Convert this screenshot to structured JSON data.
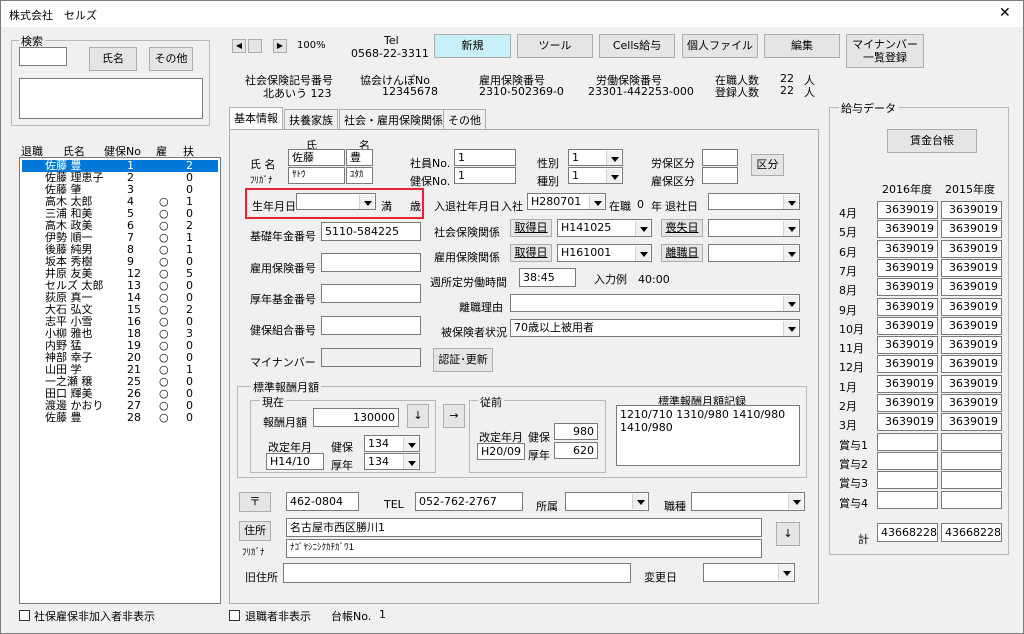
{
  "window": {
    "title": "株式会社　セルズ",
    "close": "✕"
  },
  "search": {
    "group": "検索",
    "name_button": "氏名",
    "other_button": "その他"
  },
  "list": {
    "headers": [
      "退職",
      "氏名",
      "健保No",
      "雇",
      "扶"
    ],
    "rows": [
      {
        "name": "佐藤 豊",
        "no": "1",
        "koyo": "",
        "fu": "2"
      },
      {
        "name": "佐藤 理恵子",
        "no": "2",
        "koyo": "",
        "fu": "0"
      },
      {
        "name": "佐藤 肇",
        "no": "3",
        "koyo": "",
        "fu": "0"
      },
      {
        "name": "高木 太郎",
        "no": "4",
        "koyo": "○",
        "fu": "1"
      },
      {
        "name": "三浦 和美",
        "no": "5",
        "koyo": "○",
        "fu": "0"
      },
      {
        "name": "高木 政美",
        "no": "6",
        "koyo": "○",
        "fu": "2"
      },
      {
        "name": "伊勢 順一",
        "no": "7",
        "koyo": "○",
        "fu": "1"
      },
      {
        "name": "後藤 純男",
        "no": "8",
        "koyo": "○",
        "fu": "1"
      },
      {
        "name": "坂本 秀樹",
        "no": "9",
        "koyo": "○",
        "fu": "0"
      },
      {
        "name": "井原 友美",
        "no": "12",
        "koyo": "○",
        "fu": "5"
      },
      {
        "name": "セルズ 太郎",
        "no": "13",
        "koyo": "○",
        "fu": "0"
      },
      {
        "name": "荻原 真一",
        "no": "14",
        "koyo": "○",
        "fu": "0"
      },
      {
        "name": "大石 弘文",
        "no": "15",
        "koyo": "○",
        "fu": "2"
      },
      {
        "name": "志平 小雪",
        "no": "16",
        "koyo": "○",
        "fu": "0"
      },
      {
        "name": "小柳 雅也",
        "no": "18",
        "koyo": "○",
        "fu": "3"
      },
      {
        "name": "内野 猛",
        "no": "19",
        "koyo": "○",
        "fu": "0"
      },
      {
        "name": "神部 幸子",
        "no": "20",
        "koyo": "○",
        "fu": "0"
      },
      {
        "name": "山田 学",
        "no": "21",
        "koyo": "○",
        "fu": "1"
      },
      {
        "name": "一之瀬 穣",
        "no": "25",
        "koyo": "○",
        "fu": "0"
      },
      {
        "name": "田口 輝美",
        "no": "26",
        "koyo": "○",
        "fu": "0"
      },
      {
        "name": "渡邊 かおり",
        "no": "27",
        "koyo": "○",
        "fu": "0"
      },
      {
        "name": "佐藤 豊",
        "no": "28",
        "koyo": "○",
        "fu": "0"
      }
    ]
  },
  "bottom": {
    "hide_uninsured": "社保雇保非加入者非表示",
    "hide_retired": "退職者非表示",
    "ledger_label": "台帳No.",
    "ledger_no": "1"
  },
  "toolbar": {
    "zoom": "100%",
    "tel_label": "Tel",
    "tel": "0568-22-3311",
    "new": "新規",
    "tools": "ツール",
    "cells_pay": "Cells給与",
    "personal_file": "個人ファイル",
    "edit": "編集",
    "mynumber": "マイナンバー\n一覧登録"
  },
  "info": {
    "social_ins_label": "社会保険記号番号",
    "social_ins": "北あいう 123",
    "kyokai_label": "協会けんぽNo",
    "kyokai": "12345678",
    "employment_label": "雇用保険番号",
    "employment": "2310-502369-0",
    "labor_label": "労働保険番号",
    "labor": "23301-442253-000",
    "employed_label": "在職人数",
    "employed": "22",
    "registered_label": "登録人数",
    "registered": "22",
    "unit": "人"
  },
  "tabs": [
    "基本情報",
    "扶養家族",
    "社会・雇用保険関係",
    "その他"
  ],
  "basic": {
    "sei": "氏",
    "mei": "名",
    "name_label": "氏 名",
    "furigana_label": "ﾌﾘｶﾞﾅ",
    "last": "佐藤",
    "first": "豊",
    "last_kana": "ｻﾄｳ",
    "first_kana": "ﾕﾀｶ",
    "emp_no_label": "社員No.",
    "emp_no": "1",
    "health_no_label": "健保No.",
    "health_no": "1",
    "sex_label": "性別",
    "sex": "1",
    "type_label": "種別",
    "type": "1",
    "labor_cls_label": "労保区分",
    "emp_cls_label": "雇保区分",
    "kubun_btn": "区分",
    "birth_label": "生年月日",
    "age_full": "満",
    "age_unit": "歳",
    "pension_label": "基礎年金番号",
    "pension": "5110-584225",
    "emp_ins_label": "雇用保険番号",
    "pension_fund_label": "厚年基金番号",
    "union_label": "健保組合番号",
    "mynumber_label": "マイナンバー",
    "auth_btn": "認証･更新",
    "join_label": "入退社年月日",
    "join": "入社",
    "join_date": "H280701",
    "status": "在職",
    "years": "0",
    "nen": "年",
    "leave": "退社日",
    "social_label": "社会保険関係",
    "get_btn": "取得日",
    "social_get": "H141025",
    "lose_btn": "喪失日",
    "emp_rel_label": "雇用保険関係",
    "emp_get": "H161001",
    "sep_btn": "離職日",
    "hours_label": "週所定労働時間",
    "hours": "38:45",
    "example": "入力例　40:00",
    "reason_label": "離職理由",
    "insured_label": "被保険者状況",
    "insured": "70歳以上被用者"
  },
  "std": {
    "group": "標準報酬月額",
    "current": "現在",
    "amount_label": "報酬月額",
    "amount": "130000",
    "rev_label": "改定年月",
    "rev": "H14/10",
    "health_label": "健保",
    "health": "134",
    "pension_label": "厚年",
    "pension": "134",
    "before": "従前",
    "prev_rev": "H20/09",
    "prev_health": "980",
    "prev_pension": "620",
    "record_label": "標準報酬月額記録",
    "record": "1210/710 1310/980 1410/980\n1410/980",
    "down": "↓",
    "right": "→"
  },
  "address": {
    "zip_btn": "〒",
    "zip": "462-0804",
    "tel_label": "TEL",
    "tel": "052-762-2767",
    "dept_label": "所属",
    "job_label": "職種",
    "addr_btn": "住所",
    "addr": "名古屋市西区勝川1",
    "kana_label": "ﾌﾘｶﾞﾅ",
    "addr_kana": "ﾅｺﾞﾔｼﾆｼｸｶﾁｶﾞﾜ1",
    "old_label": "旧住所",
    "change_label": "変更日",
    "down": "↓"
  },
  "pay": {
    "group": "給与データ",
    "ledger_btn": "賃金台帳",
    "year1": "2016年度",
    "year2": "2015年度",
    "months": [
      "4月",
      "5月",
      "6月",
      "7月",
      "8月",
      "9月",
      "10月",
      "11月",
      "12月",
      "1月",
      "2月",
      "3月",
      "賞与1",
      "賞与2",
      "賞与3",
      "賞与4"
    ],
    "v2016": [
      "3639019",
      "3639019",
      "3639019",
      "3639019",
      "3639019",
      "3639019",
      "3639019",
      "3639019",
      "3639019",
      "3639019",
      "3639019",
      "3639019",
      "",
      "",
      "",
      ""
    ],
    "v2015": [
      "3639019",
      "3639019",
      "3639019",
      "3639019",
      "3639019",
      "3639019",
      "3639019",
      "3639019",
      "3639019",
      "3639019",
      "3639019",
      "3639019",
      "",
      "",
      "",
      ""
    ],
    "total_label": "計",
    "total2016": "43668228",
    "total2015": "43668228"
  },
  "colors": {
    "accent": "#0078d7",
    "highlight": "#c8f0f8",
    "emphasis": "#e8252c"
  }
}
